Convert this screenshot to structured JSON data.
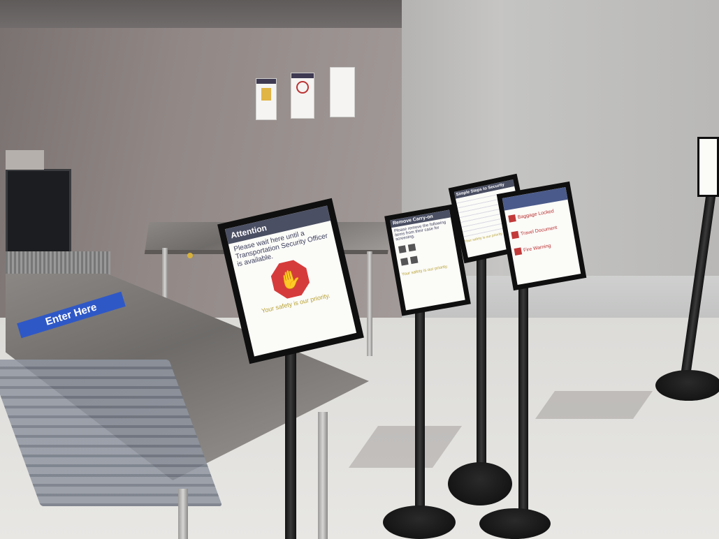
{
  "signs": {
    "attention": {
      "title": "Attention",
      "body": "Please wait here until a Transportation Security Officer is available.",
      "footer": "Your safety is our priority."
    },
    "carry_on": {
      "title": "Remove Carry-on",
      "body": "Please remove the following items from their case for screening.",
      "footer": "Your safety is our priority."
    },
    "steps": {
      "title": "Simple Steps to Security",
      "footer": "Your safety is our priority."
    },
    "warning": {
      "items": [
        "Baggage Locked",
        "Travel Document",
        "Fire Warning"
      ]
    }
  },
  "floor_sign": {
    "label": "Enter Here"
  },
  "colors": {
    "sign_title": "#4b4f63",
    "stop": "#d63b3b",
    "footer": "#b8a232",
    "floor_sign": "#2f58c7"
  }
}
